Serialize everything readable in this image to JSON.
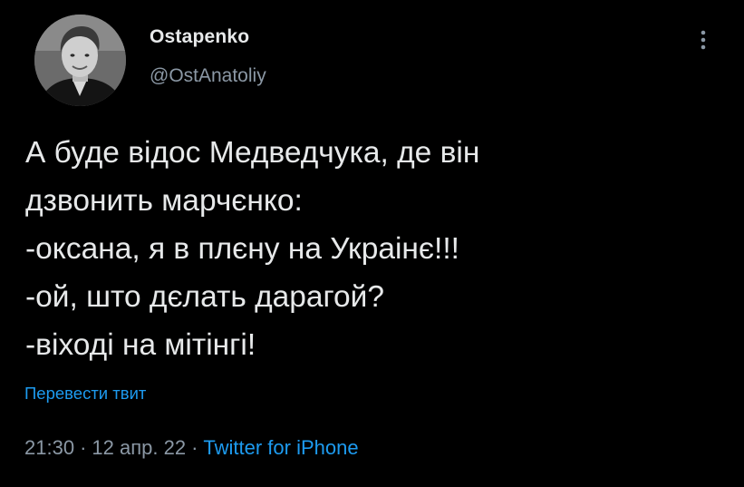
{
  "author": {
    "display_name": "Ostapenko",
    "handle": "@OstAnatoliy"
  },
  "tweet": {
    "text": "А буде відос Медведчука, де він\nдзвонить марчєнко:\n-оксана, я в плєну на Украінє!!!\n-ой, што дєлать дарагой?\n-віході на мітінгі!",
    "translate_label": "Перевести твит",
    "time": "21:30",
    "date": "12 апр. 22",
    "separator": "·",
    "source": "Twitter for iPhone"
  },
  "icons": {
    "more": "more-vertical-icon",
    "avatar": "profile-photo"
  },
  "colors": {
    "background": "#000000",
    "text": "#e7e9ea",
    "secondary": "#8b98a5",
    "accent": "#1d9bf0"
  }
}
